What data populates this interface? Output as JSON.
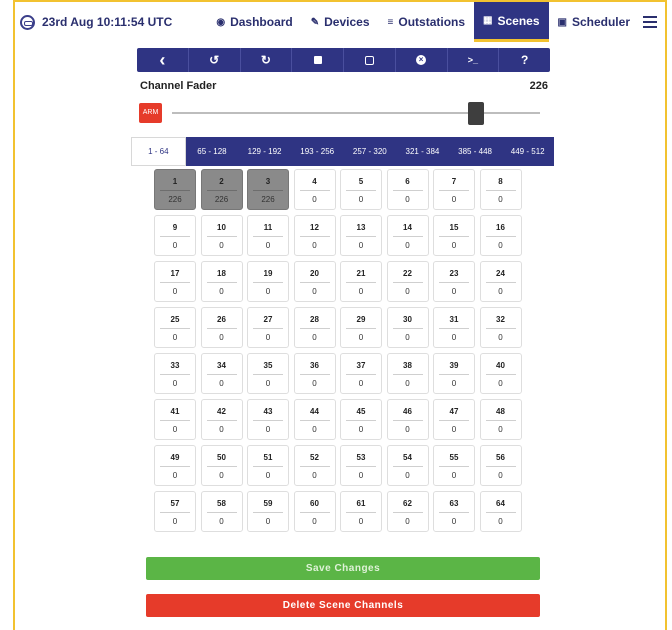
{
  "header": {
    "clock": "23rd Aug 10:11:54 UTC",
    "nav": [
      {
        "label": "Dashboard",
        "icon": "dashboard-icon",
        "active": false
      },
      {
        "label": "Devices",
        "icon": "devices-icon",
        "active": false
      },
      {
        "label": "Outstations",
        "icon": "outstations-icon",
        "active": false
      },
      {
        "label": "Scenes",
        "icon": "scenes-icon",
        "active": true
      },
      {
        "label": "Scheduler",
        "icon": "calendar-icon",
        "active": false
      }
    ]
  },
  "toolbar": {
    "glyphs": {
      "back": "‹",
      "undo": "↺",
      "redo": "↻",
      "close": "×",
      "console": ">_",
      "help": "?"
    }
  },
  "fader": {
    "label": "Channel Fader",
    "value": "226",
    "arm_label": "ARM",
    "level": 226,
    "max": 255
  },
  "ranges": [
    "1 - 64",
    "65 - 128",
    "129 - 192",
    "193 - 256",
    "257 - 320",
    "321 - 384",
    "385 - 448",
    "449 - 512"
  ],
  "active_range": 0,
  "channels": [
    {
      "n": "1",
      "v": "226",
      "sel": true
    },
    {
      "n": "2",
      "v": "226",
      "sel": true
    },
    {
      "n": "3",
      "v": "226",
      "sel": true
    },
    {
      "n": "4",
      "v": "0"
    },
    {
      "n": "5",
      "v": "0"
    },
    {
      "n": "6",
      "v": "0"
    },
    {
      "n": "7",
      "v": "0"
    },
    {
      "n": "8",
      "v": "0"
    },
    {
      "n": "9",
      "v": "0"
    },
    {
      "n": "10",
      "v": "0"
    },
    {
      "n": "11",
      "v": "0"
    },
    {
      "n": "12",
      "v": "0"
    },
    {
      "n": "13",
      "v": "0"
    },
    {
      "n": "14",
      "v": "0"
    },
    {
      "n": "15",
      "v": "0"
    },
    {
      "n": "16",
      "v": "0"
    },
    {
      "n": "17",
      "v": "0"
    },
    {
      "n": "18",
      "v": "0"
    },
    {
      "n": "19",
      "v": "0"
    },
    {
      "n": "20",
      "v": "0"
    },
    {
      "n": "21",
      "v": "0"
    },
    {
      "n": "22",
      "v": "0"
    },
    {
      "n": "23",
      "v": "0"
    },
    {
      "n": "24",
      "v": "0"
    },
    {
      "n": "25",
      "v": "0"
    },
    {
      "n": "26",
      "v": "0"
    },
    {
      "n": "27",
      "v": "0"
    },
    {
      "n": "28",
      "v": "0"
    },
    {
      "n": "29",
      "v": "0"
    },
    {
      "n": "30",
      "v": "0"
    },
    {
      "n": "31",
      "v": "0"
    },
    {
      "n": "32",
      "v": "0"
    },
    {
      "n": "33",
      "v": "0"
    },
    {
      "n": "34",
      "v": "0"
    },
    {
      "n": "35",
      "v": "0"
    },
    {
      "n": "36",
      "v": "0"
    },
    {
      "n": "37",
      "v": "0"
    },
    {
      "n": "38",
      "v": "0"
    },
    {
      "n": "39",
      "v": "0"
    },
    {
      "n": "40",
      "v": "0"
    },
    {
      "n": "41",
      "v": "0"
    },
    {
      "n": "42",
      "v": "0"
    },
    {
      "n": "43",
      "v": "0"
    },
    {
      "n": "44",
      "v": "0"
    },
    {
      "n": "45",
      "v": "0"
    },
    {
      "n": "46",
      "v": "0"
    },
    {
      "n": "47",
      "v": "0"
    },
    {
      "n": "48",
      "v": "0"
    },
    {
      "n": "49",
      "v": "0"
    },
    {
      "n": "50",
      "v": "0"
    },
    {
      "n": "51",
      "v": "0"
    },
    {
      "n": "52",
      "v": "0"
    },
    {
      "n": "53",
      "v": "0"
    },
    {
      "n": "54",
      "v": "0"
    },
    {
      "n": "55",
      "v": "0"
    },
    {
      "n": "56",
      "v": "0"
    },
    {
      "n": "57",
      "v": "0"
    },
    {
      "n": "58",
      "v": "0"
    },
    {
      "n": "59",
      "v": "0"
    },
    {
      "n": "60",
      "v": "0"
    },
    {
      "n": "61",
      "v": "0"
    },
    {
      "n": "62",
      "v": "0"
    },
    {
      "n": "63",
      "v": "0"
    },
    {
      "n": "64",
      "v": "0"
    }
  ],
  "actions": {
    "save_label": "Save Changes",
    "delete_label": "Delete Scene Channels"
  },
  "colors": {
    "brand": "#2f3483",
    "accent": "#f2c230",
    "save": "#5bb546",
    "danger": "#e63b2a"
  }
}
